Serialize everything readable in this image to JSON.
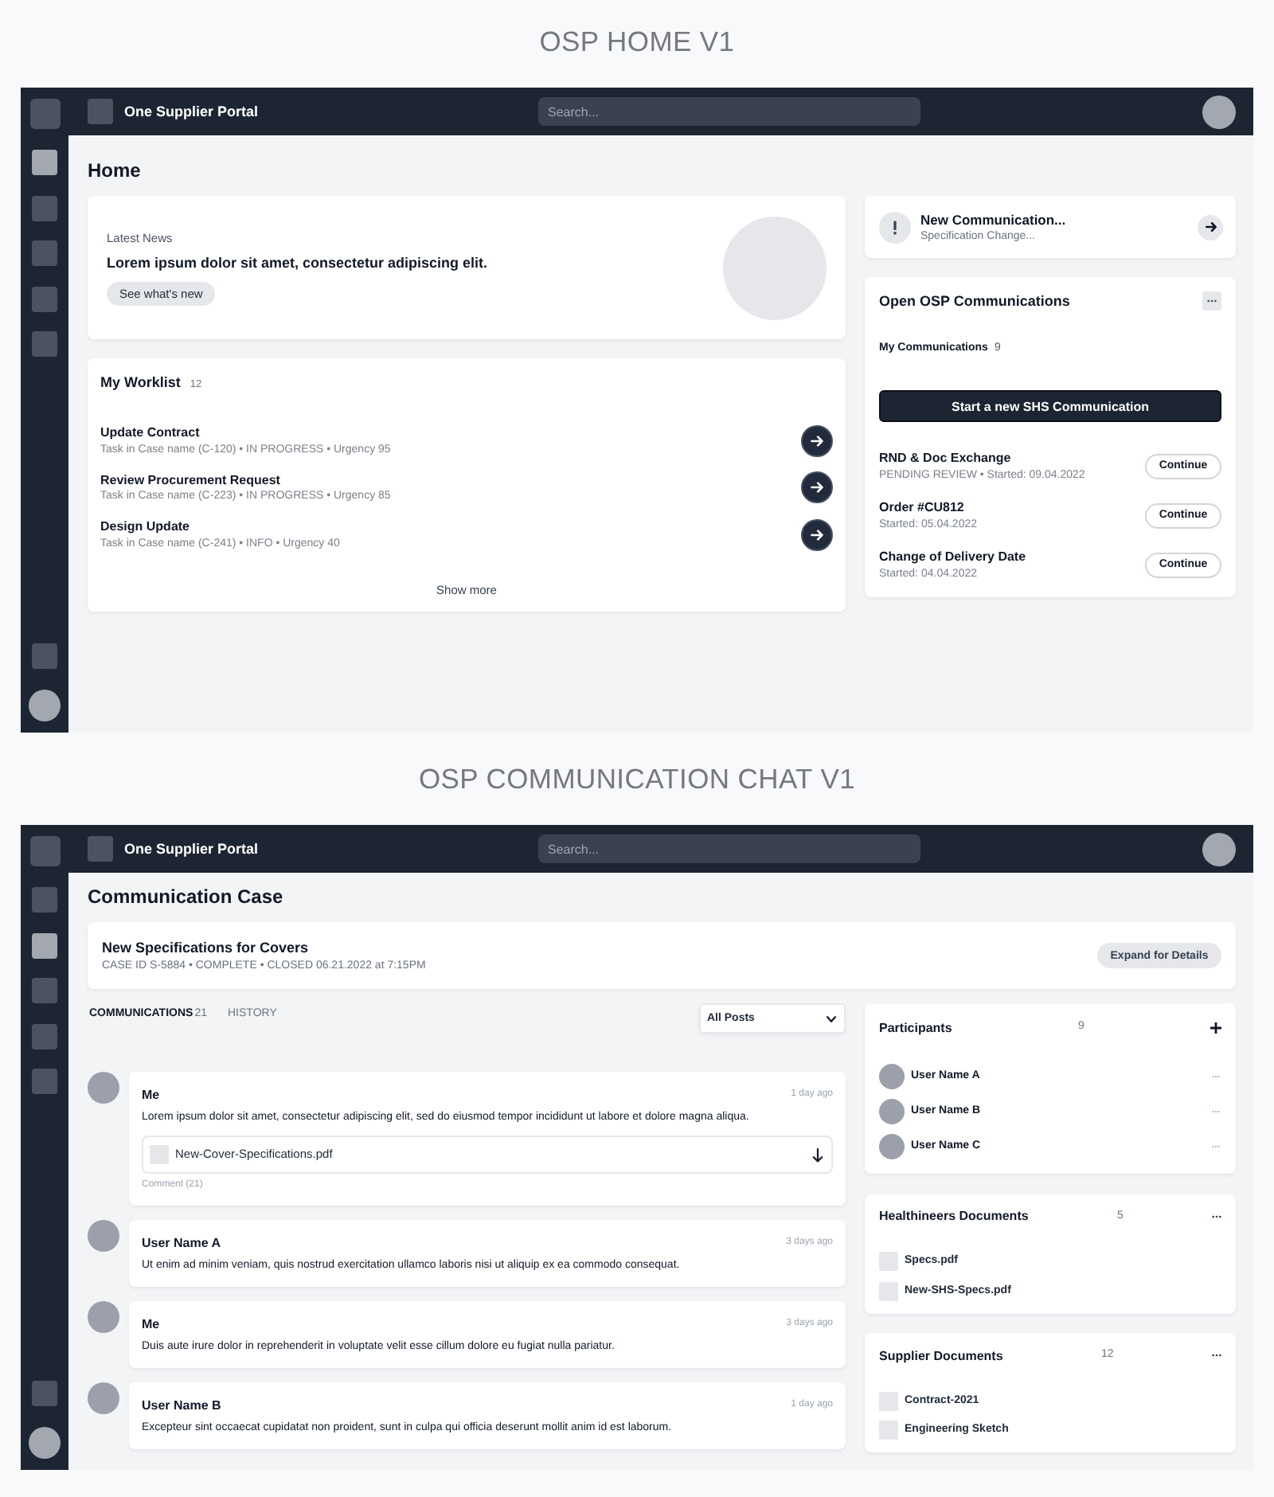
{
  "screens": [
    {
      "kind": "home",
      "caption": "OSP HOME V1",
      "top_bar": {
        "app_name": "One Supplier Portal",
        "search": {
          "placeholder": "Search..."
        }
      },
      "sidebar": {
        "items": [
          {
            "selected": true
          },
          {
            "selected": false
          },
          {
            "selected": false
          },
          {
            "selected": false
          },
          {
            "selected": false
          }
        ]
      },
      "page_title": "Home",
      "news": {
        "label": "Latest News",
        "headline": "Lorem ipsum dolor sit amet, consectetur adipiscing elit.",
        "button": "See what's new"
      },
      "worklist": {
        "title": "My Worklist",
        "count": "12",
        "items": [
          {
            "title": "Update Contract",
            "details": "Task in Case name (C-120) • IN PROGRESS • Urgency 95"
          },
          {
            "title": "Review Procurement Request",
            "details": "Task in Case name (C-223) • IN PROGRESS • Urgency 85"
          },
          {
            "title": "Design Update",
            "details": "Task in Case name (C-241) • INFO • Urgency 40"
          }
        ],
        "show_more": "Show more"
      },
      "notification": {
        "title": "New Communication...",
        "subtitle": "Specification Change..."
      },
      "communications": {
        "title": "Open OSP Communications",
        "my_label": "My Communications",
        "my_count": "9",
        "start_button": "Start a new SHS Communication",
        "items": [
          {
            "title": "RND & Doc Exchange",
            "details": "PENDING REVIEW • Started: 09.04.2022",
            "action": "Continue"
          },
          {
            "title": "Order #CU812",
            "details": "Started: 05.04.2022",
            "action": "Continue"
          },
          {
            "title": "Change of Delivery Date",
            "details": "Started: 04.04.2022",
            "action": "Continue"
          }
        ]
      }
    },
    {
      "kind": "chat",
      "caption": "OSP COMMUNICATION CHAT V1",
      "top_bar": {
        "app_name": "One Supplier Portal",
        "search": {
          "placeholder": "Search..."
        }
      },
      "sidebar": {
        "items": [
          {
            "selected": false
          },
          {
            "selected": true
          },
          {
            "selected": false
          },
          {
            "selected": false
          },
          {
            "selected": false
          }
        ]
      },
      "page_title": "Communication Case",
      "case": {
        "title": "New Specifications for Covers",
        "meta": "CASE ID S-5884 • COMPLETE • CLOSED 06.21.2022 at 7:15PM",
        "button": "Expand for Details"
      },
      "tabs": [
        {
          "label": "COMMUNICATIONS",
          "count": "21",
          "selected": true
        },
        {
          "label": "HISTORY",
          "selected": false
        }
      ],
      "filter": {
        "value": "All Posts"
      },
      "messages": [
        {
          "author": "Me",
          "time": "1 day ago",
          "text": "Lorem ipsum dolor sit amet, consectetur adipiscing elit, sed do eiusmod tempor incididunt ut labore et dolore magna aliqua.",
          "attachment": {
            "name": "New-Cover-Specifications.pdf"
          },
          "comments": "Comment (21)"
        },
        {
          "author": "User Name A",
          "time": "3 days ago",
          "text": "Ut enim ad minim veniam, quis nostrud exercitation ullamco laboris nisi ut aliquip ex ea commodo consequat."
        },
        {
          "author": "Me",
          "time": "3 days ago",
          "text": "Duis aute irure dolor in reprehenderit in voluptate velit esse cillum dolore eu fugiat nulla pariatur."
        },
        {
          "author": "User Name B",
          "time": "1 day ago",
          "text": "Excepteur sint occaecat cupidatat non proident, sunt in culpa qui officia deserunt mollit anim id est laborum."
        }
      ],
      "participants": {
        "title": "Participants",
        "count": "9",
        "users": [
          {
            "name": "User Name A"
          },
          {
            "name": "User Name B"
          },
          {
            "name": "User Name C"
          }
        ]
      },
      "document_lists": [
        {
          "title": "Healthineers Documents",
          "count": "5",
          "files": [
            {
              "name": "Specs.pdf"
            },
            {
              "name": "New-SHS-Specs.pdf"
            }
          ]
        },
        {
          "title": "Supplier Documents",
          "count": "12",
          "files": [
            {
              "name": "Contract-2021"
            },
            {
              "name": "Engineering Sketch"
            }
          ]
        }
      ]
    }
  ]
}
